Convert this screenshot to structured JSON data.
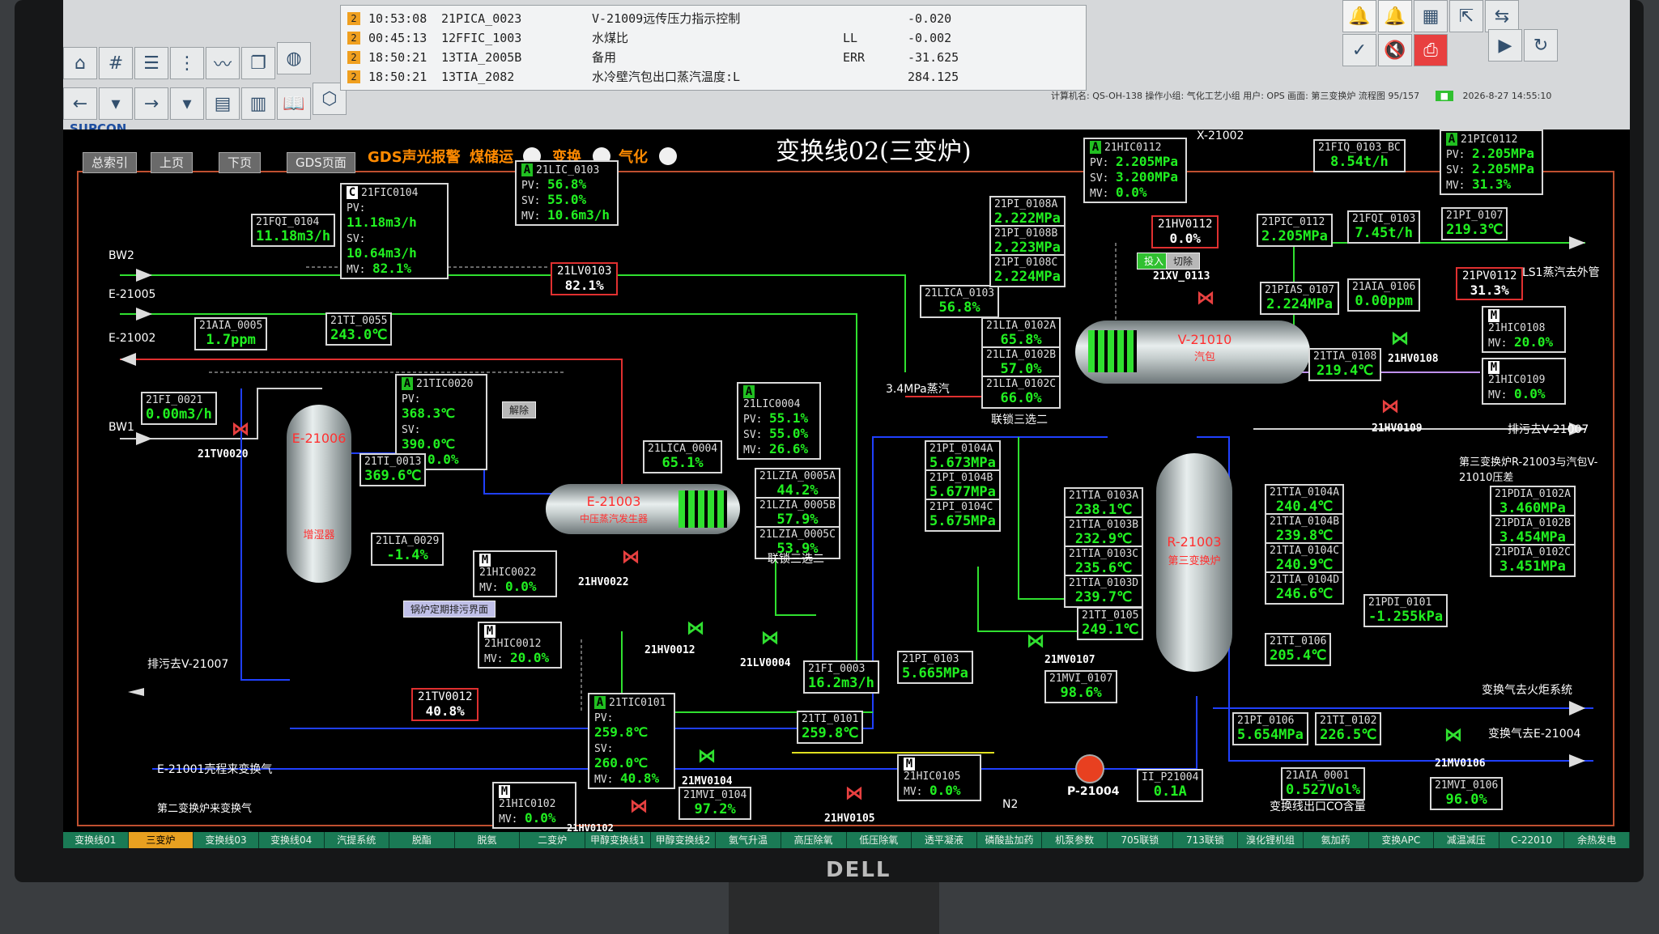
{
  "brand": "SUPCON",
  "monitor_logo": "DELL",
  "alarms": [
    {
      "pri": "2",
      "time": "10:53:08",
      "tag": "21PICA_0023",
      "desc": "V-21009远传压力指示控制",
      "code": "",
      "value": "-0.020"
    },
    {
      "pri": "2",
      "time": "00:45:13",
      "tag": "12FFIC_1003",
      "desc": "水煤比",
      "code": "LL",
      "value": "-0.002"
    },
    {
      "pri": "2",
      "time": "18:50:21",
      "tag": "13TIA_2005B",
      "desc": "备用",
      "code": "ERR",
      "value": "-31.625"
    },
    {
      "pri": "2",
      "time": "18:50:21",
      "tag": "13TIA_2082",
      "desc": "水冷壁汽包出口蒸汽温度:L",
      "code": "",
      "value": "284.125"
    }
  ],
  "info_bar": "计算机名: QS-OH-138   操作小组: 气化工艺小组   用户: OPS   画面: 第三变换炉   流程图   95/157",
  "info_date": "2026-8-27 14:55:10",
  "title": "变换线02(三变炉)",
  "nav": [
    "总索引",
    "上页",
    "下页",
    "GDS页面"
  ],
  "gds": {
    "label": "GDS声光报警",
    "items": [
      "煤储运",
      "变换",
      "气化"
    ]
  },
  "tags": [
    {
      "id": "21FQI_0104",
      "v": "11.18m3/h"
    },
    {
      "id": "21AIA_0005",
      "v": "1.7ppm"
    },
    {
      "id": "21TI_0055",
      "v": "243.0℃"
    },
    {
      "id": "21FI_0021",
      "v": "0.00m3/h"
    },
    {
      "id": "21TI_0013",
      "v": "369.6℃"
    },
    {
      "id": "21LIA_0029",
      "v": "-1.4%"
    },
    {
      "id": "21LICA_0004",
      "v": "65.1%"
    },
    {
      "id": "21LZIA_0005A",
      "v": "44.2%"
    },
    {
      "id": "21LZIA_0005B",
      "v": "57.9%"
    },
    {
      "id": "21LZIA_0005C",
      "v": "53.9%"
    },
    {
      "id": "21LICA_0103",
      "v": "56.8%"
    },
    {
      "id": "21PI_0108A",
      "v": "2.222MPa"
    },
    {
      "id": "21PI_0108B",
      "v": "2.223MPa"
    },
    {
      "id": "21PI_0108C",
      "v": "2.224MPa"
    },
    {
      "id": "21LIA_0102A",
      "v": "65.8%"
    },
    {
      "id": "21LIA_0102B",
      "v": "57.0%"
    },
    {
      "id": "21LIA_0102C",
      "v": "66.0%"
    },
    {
      "id": "21FIQ_0103_BC",
      "v": "8.54t/h"
    },
    {
      "id": "21PIC_0112",
      "v": "2.205MPa"
    },
    {
      "id": "21FQI_0103",
      "v": "7.45t/h"
    },
    {
      "id": "21PI_0107",
      "v": "219.3℃"
    },
    {
      "id": "21PIAS_0107",
      "v": "2.224MPa"
    },
    {
      "id": "21AIA_0106",
      "v": "0.00ppm"
    },
    {
      "id": "21TIA_0108",
      "v": "219.4℃"
    },
    {
      "id": "21PI_0104A",
      "v": "5.673MPa"
    },
    {
      "id": "21PI_0104B",
      "v": "5.677MPa"
    },
    {
      "id": "21PI_0104C",
      "v": "5.675MPa"
    },
    {
      "id": "21TIA_0103A",
      "v": "238.1℃"
    },
    {
      "id": "21TIA_0103B",
      "v": "232.9℃"
    },
    {
      "id": "21TIA_0103C",
      "v": "235.6℃"
    },
    {
      "id": "21TIA_0103D",
      "v": "239.7℃"
    },
    {
      "id": "21TI_0105",
      "v": "249.1℃"
    },
    {
      "id": "21TIA_0104A",
      "v": "240.4℃"
    },
    {
      "id": "21TIA_0104B",
      "v": "239.8℃"
    },
    {
      "id": "21TIA_0104C",
      "v": "240.9℃"
    },
    {
      "id": "21TIA_0104D",
      "v": "246.6℃"
    },
    {
      "id": "21TI_0106",
      "v": "205.4℃"
    },
    {
      "id": "21PDIA_0102A",
      "v": "3.460MPa"
    },
    {
      "id": "21PDIA_0102B",
      "v": "3.454MPa"
    },
    {
      "id": "21PDIA_0102C",
      "v": "3.451MPa"
    },
    {
      "id": "21PDI_0101",
      "v": "-1.255kPa"
    },
    {
      "id": "21FI_0003",
      "v": "16.2m3/h"
    },
    {
      "id": "21PI_0103",
      "v": "5.665MPa"
    },
    {
      "id": "21TI_0101",
      "v": "259.8℃"
    },
    {
      "id": "21MVI_0104",
      "v": "97.2%"
    },
    {
      "id": "21MVI_0107",
      "v": "98.6%"
    },
    {
      "id": "21PI_0106",
      "v": "5.654MPa"
    },
    {
      "id": "21TI_0102",
      "v": "226.5℃"
    },
    {
      "id": "II_P21004",
      "v": "0.1A"
    },
    {
      "id": "21AIA_0001",
      "v": "0.527Vol%"
    },
    {
      "id": "21MVI_0106",
      "v": "96.0%"
    }
  ],
  "controllers": {
    "fic0104": {
      "mode": "C",
      "id": "21FIC0104",
      "pv": "11.18m3/h",
      "sv": "10.64m3/h",
      "mv": "82.1%"
    },
    "lic0103": {
      "mode": "A",
      "id": "21LIC_0103",
      "pv": "56.8%",
      "sv": "55.0%",
      "mv": "10.6m3/h"
    },
    "tic0020": {
      "mode": "A",
      "id": "21TIC0020",
      "pv": "368.3℃",
      "sv": "390.0℃",
      "mv": "0.0%"
    },
    "lic0004": {
      "mode": "A",
      "id": "21LIC0004",
      "pv": "55.1%",
      "sv": "55.0%",
      "mv": "26.6%"
    },
    "hic0112": {
      "mode": "A",
      "id": "21HIC0112",
      "pv": "2.205MPa",
      "sv": "3.200MPa",
      "mv": "0.0%"
    },
    "pic0112": {
      "mode": "A",
      "id": "21PIC0112",
      "pv": "2.205MPa",
      "sv": "2.205MPa",
      "mv": "31.3%"
    },
    "tic0101": {
      "mode": "A",
      "id": "21TIC0101",
      "pv": "259.8℃",
      "sv": "260.0℃",
      "mv": "40.8%"
    }
  },
  "manual": {
    "hic0022": {
      "id": "21HIC0022",
      "mv": "0.0%"
    },
    "hic0012": {
      "id": "21HIC0012",
      "mv": "20.0%"
    },
    "hic0102": {
      "id": "21HIC0102",
      "mv": "0.0%"
    },
    "hic0105": {
      "id": "21HIC0105",
      "mv": "0.0%"
    },
    "hic0108": {
      "id": "21HIC0108",
      "mv": "20.0%"
    },
    "hic0109": {
      "id": "21HIC0109",
      "mv": "0.0%"
    }
  },
  "valve_boxes": [
    {
      "id": "21LV0103",
      "v": "82.1%"
    },
    {
      "id": "21HV0112",
      "v": "0.0%"
    },
    {
      "id": "21PV0112",
      "v": "31.3%"
    },
    {
      "id": "21TV0012",
      "v": "40.8%"
    }
  ],
  "valves": [
    "21TV0020",
    "21HV0022",
    "21HV0012",
    "21LV0004",
    "21MV0104",
    "21HV0102",
    "21HV0105",
    "21MV0107",
    "21XV_0113",
    "21HV0108",
    "21HV0109",
    "21MV0106"
  ],
  "vessels": {
    "e21006": {
      "tag": "E-21006",
      "sub": "增湿器"
    },
    "e21003": {
      "tag": "E-21003",
      "sub": "中压蒸汽发生器"
    },
    "v21010": {
      "tag": "V-21010",
      "sub": "汽包"
    },
    "r21003": {
      "tag": "R-21003",
      "sub": "第三变换炉"
    },
    "x21002": {
      "tag": "X-21002"
    },
    "p21004": {
      "tag": "P-21004"
    }
  },
  "labels": {
    "bw2": "BW2",
    "e21005": "E-21005",
    "e21002": "E-21002",
    "bw1": "BW1",
    "steam34": "3.4MPa蒸汽",
    "lock1": "联锁三选二",
    "lock2": "联锁三选二",
    "ls1": "LS1蒸汽去外管",
    "drain_v21007": "排污去V-21007",
    "drain_v21007b": "排污去V-21007",
    "r21003_note": "第三变换炉R-21003与汽包V-21010压差",
    "flare": "变换气去火炬系统",
    "to_e21004": "变换气去E-21004",
    "from_e21001": "E-21001壳程来变换气",
    "from_second": "第二变换炉来变换气",
    "n2": "N2",
    "co_outlet": "变换线出口CO含量",
    "btn_bypass": "解除",
    "btn_cut1": "投入",
    "btn_cut2": "切除",
    "btn_blowdown": "锅炉定期排污界面"
  },
  "bottom_tabs": [
    "变换线01",
    "三变炉",
    "变换线03",
    "变换线04",
    "汽提系统",
    "脱酯",
    "脱氨",
    "二变炉",
    "甲醇变换线1",
    "甲醇变换线2",
    "氨气升温",
    "高压除氧",
    "低压除氧",
    "透平凝液",
    "磷酸盐加药",
    "机泵参数",
    "705联锁",
    "713联锁",
    "溴化锂机组",
    "氨加药",
    "变换APC",
    "减温减压",
    "C-22010",
    "余热发电"
  ],
  "selected_tab": 1
}
